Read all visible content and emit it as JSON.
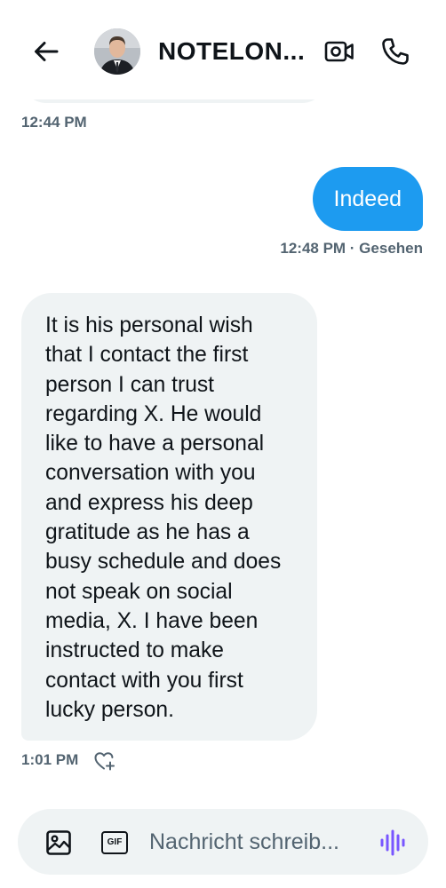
{
  "header": {
    "contact_name": "NOTELON...",
    "back_icon": "arrow-left-icon",
    "video_icon": "video-camera-icon",
    "call_icon": "phone-icon"
  },
  "messages": [
    {
      "direction": "in",
      "text": "",
      "time": "12:44 PM"
    },
    {
      "direction": "out",
      "text": "Indeed",
      "meta": "12:48 PM · Gesehen"
    },
    {
      "direction": "in",
      "text": "It is his personal wish that I contact the first person I can trust regarding X. He would like to have a personal conversation with you and express his deep gratitude as he has a busy schedule and does not speak on social media, X. I have been instructed to make contact with you first lucky person.",
      "time": "1:01 PM",
      "reaction_icon": "heart-plus-icon"
    }
  ],
  "composer": {
    "placeholder": "Nachricht schreib...",
    "gif_label": "GIF",
    "media_icon": "image-icon",
    "voice_icon": "voice-wave-icon"
  },
  "colors": {
    "accent": "#1d9bf0",
    "incoming_bubble": "#eff3f4",
    "muted_text": "#536471",
    "voice_accent": "#7856ff"
  }
}
